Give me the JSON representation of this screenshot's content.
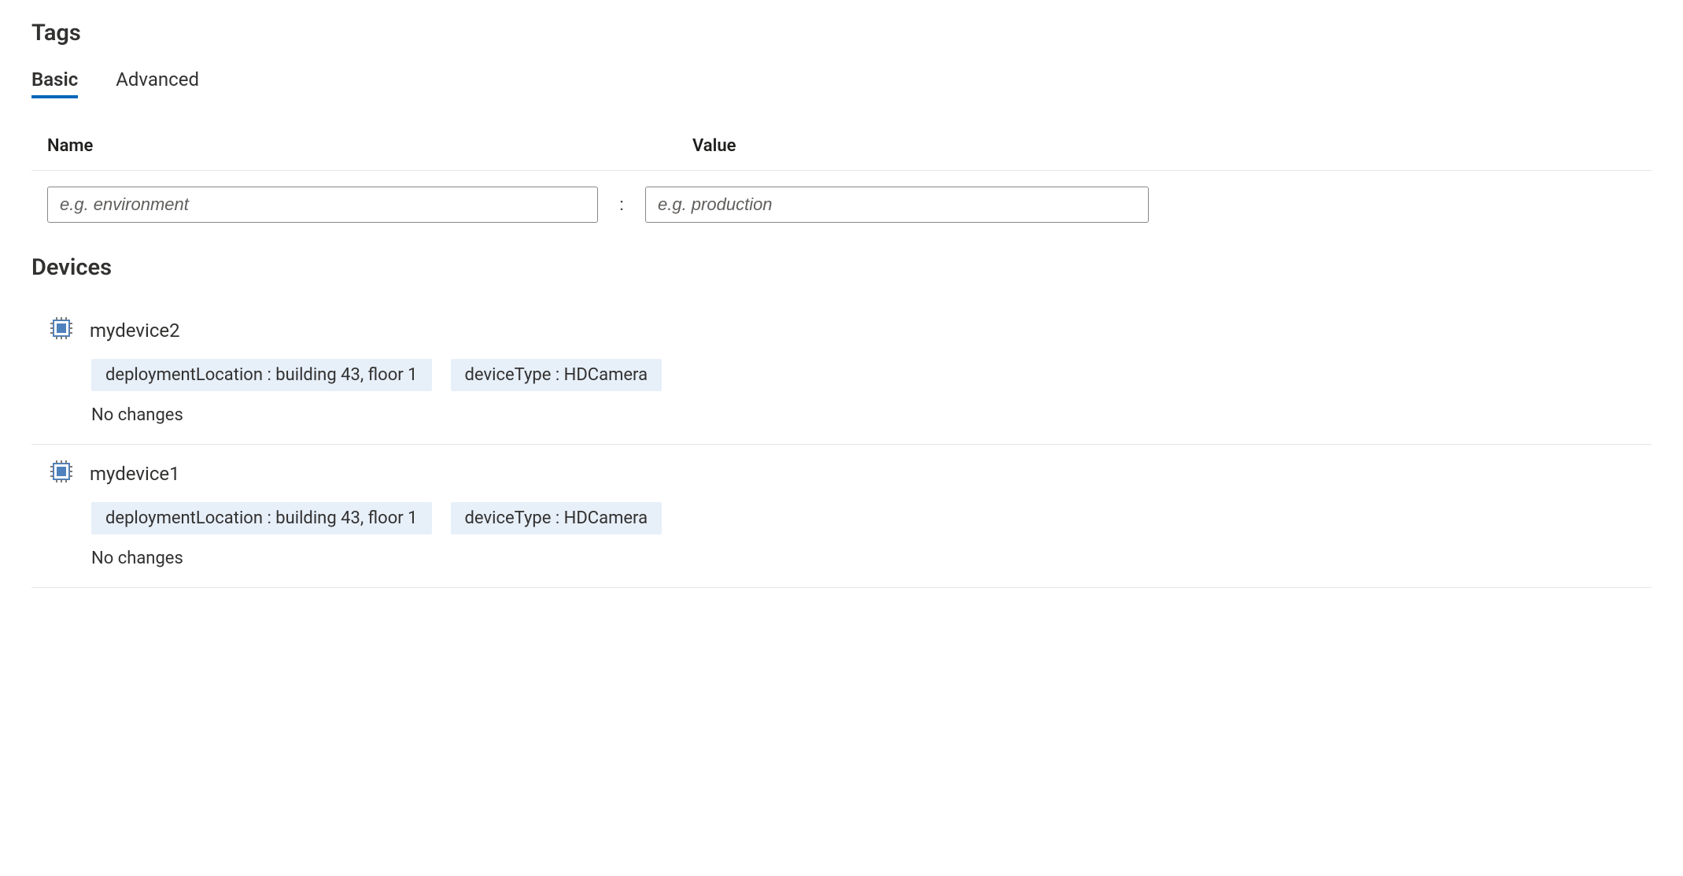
{
  "tags_section": {
    "heading": "Tags",
    "tabs": {
      "basic": "Basic",
      "advanced": "Advanced"
    },
    "columns": {
      "name": "Name",
      "value": "Value"
    },
    "separator": ":",
    "name_placeholder": "e.g. environment",
    "value_placeholder": "e.g. production"
  },
  "devices_section": {
    "heading": "Devices",
    "devices": [
      {
        "name": "mydevice2",
        "tags": [
          {
            "text": "deploymentLocation : building 43, floor 1"
          },
          {
            "text": "deviceType : HDCamera"
          }
        ],
        "status": "No changes"
      },
      {
        "name": "mydevice1",
        "tags": [
          {
            "text": "deploymentLocation : building 43, floor 1"
          },
          {
            "text": "deviceType : HDCamera"
          }
        ],
        "status": "No changes"
      }
    ]
  }
}
